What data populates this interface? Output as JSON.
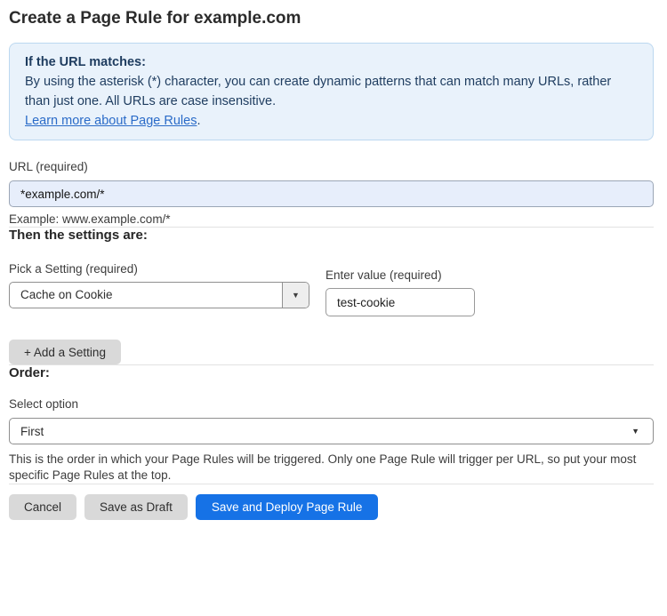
{
  "page": {
    "title": "Create a Page Rule for example.com"
  },
  "info_box": {
    "heading": "If the URL matches:",
    "body": "By using the asterisk (*) character, you can create dynamic patterns that can match many URLs, rather than just one. All URLs are case insensitive.",
    "link_label": "Learn more about Page Rules",
    "link_suffix": "."
  },
  "url_field": {
    "label": "URL (required)",
    "value": "*example.com/*",
    "example": "Example: www.example.com/*"
  },
  "settings_section": {
    "heading": "Then the settings are:",
    "setting_label": "Pick a Setting (required)",
    "setting_value": "Cache on Cookie",
    "value_label": "Enter value (required)",
    "value_value": "test-cookie",
    "add_setting_label": "+ Add a Setting"
  },
  "order_section": {
    "heading": "Order:",
    "select_label": "Select option",
    "selected_option": "First",
    "help_text": "This is the order in which your Page Rules will be triggered. Only one Page Rule will trigger per URL, so put your most specific Page Rules at the top."
  },
  "footer": {
    "cancel_label": "Cancel",
    "save_draft_label": "Save as Draft",
    "save_deploy_label": "Save and Deploy Page Rule"
  },
  "icons": {
    "dropdown_arrow": "▼"
  },
  "colors": {
    "info_box_bg": "#e9f2fb",
    "info_box_border": "#bcd8f0",
    "info_text": "#1e3c5f",
    "link": "#2a6bc8",
    "url_input_bg": "#e7eefb",
    "primary_button_bg": "#1672e6",
    "gray_button_bg": "#d9d9d9",
    "divider": "#e2e2e2"
  }
}
